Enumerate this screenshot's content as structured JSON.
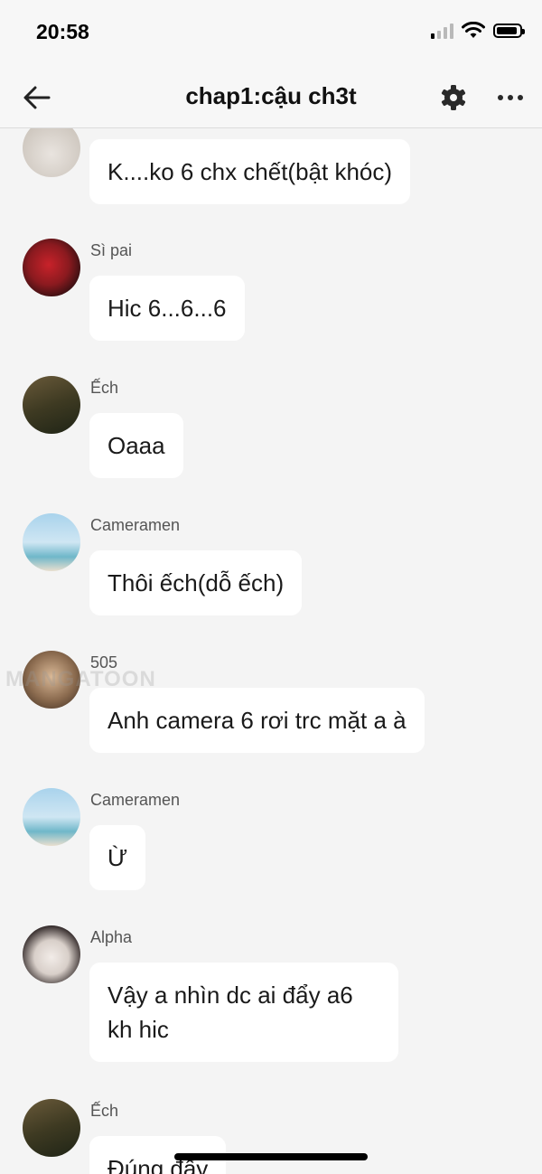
{
  "status_bar": {
    "time": "20:58"
  },
  "header": {
    "title": "chap1:cậu ch3t"
  },
  "icons": {
    "back": "arrow-left-icon",
    "settings": "gear-icon",
    "more": "ellipsis-icon",
    "signal": "signal-icon",
    "wifi": "wifi-icon",
    "battery": "battery-icon"
  },
  "messages": [
    {
      "sender": "",
      "text": "K....ko 6 chx chết(bật khóc)"
    },
    {
      "sender": "Sì pai",
      "text": "Hic 6...6...6"
    },
    {
      "sender": "Ếch",
      "text": "Oaaa"
    },
    {
      "sender": "Cameramen",
      "text": "Thôi ếch(dỗ ếch)"
    },
    {
      "sender": "505",
      "text": "Anh camera 6 rơi trc mặt a à"
    },
    {
      "sender": "Cameramen",
      "text": "Ừ"
    },
    {
      "sender": "Alpha",
      "text": "Vậy a nhìn dc ai đẩy a6 kh hic"
    },
    {
      "sender": "Ếch",
      "text": "Đúng đấy"
    }
  ],
  "watermark": "MANGATOON",
  "colors": {
    "background": "#f4f4f4",
    "bubble": "#ffffff",
    "header": "#f7f7f7"
  }
}
